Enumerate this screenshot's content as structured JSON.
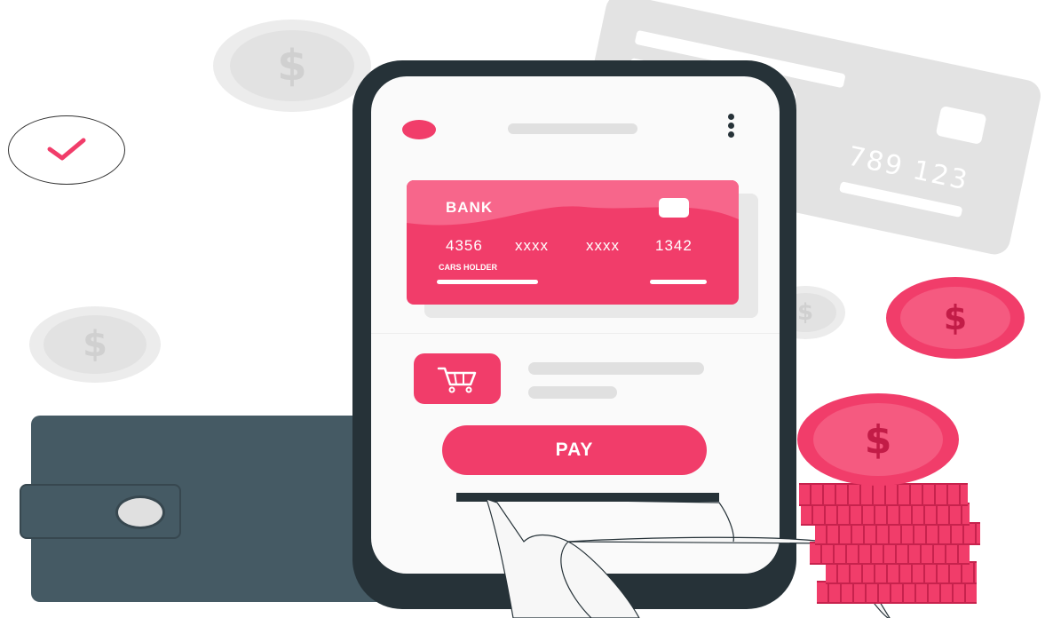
{
  "colors": {
    "accent": "#f13d6a",
    "phone_frame": "#263238",
    "wallet": "#455a64",
    "background_card": "#e3e3e3"
  },
  "background_card": {
    "number": "789 123"
  },
  "bank_card": {
    "bank_name": "BANK",
    "number_groups": [
      "4356",
      "xxxx",
      "xxxx",
      "1342"
    ],
    "holder_label": "CARS HOLDER"
  },
  "pay_button": {
    "label": "PAY"
  },
  "icons": {
    "coin_symbol": "$",
    "check": "check-icon",
    "cart": "shopping-cart-icon",
    "menu": "kebab-menu-icon"
  }
}
